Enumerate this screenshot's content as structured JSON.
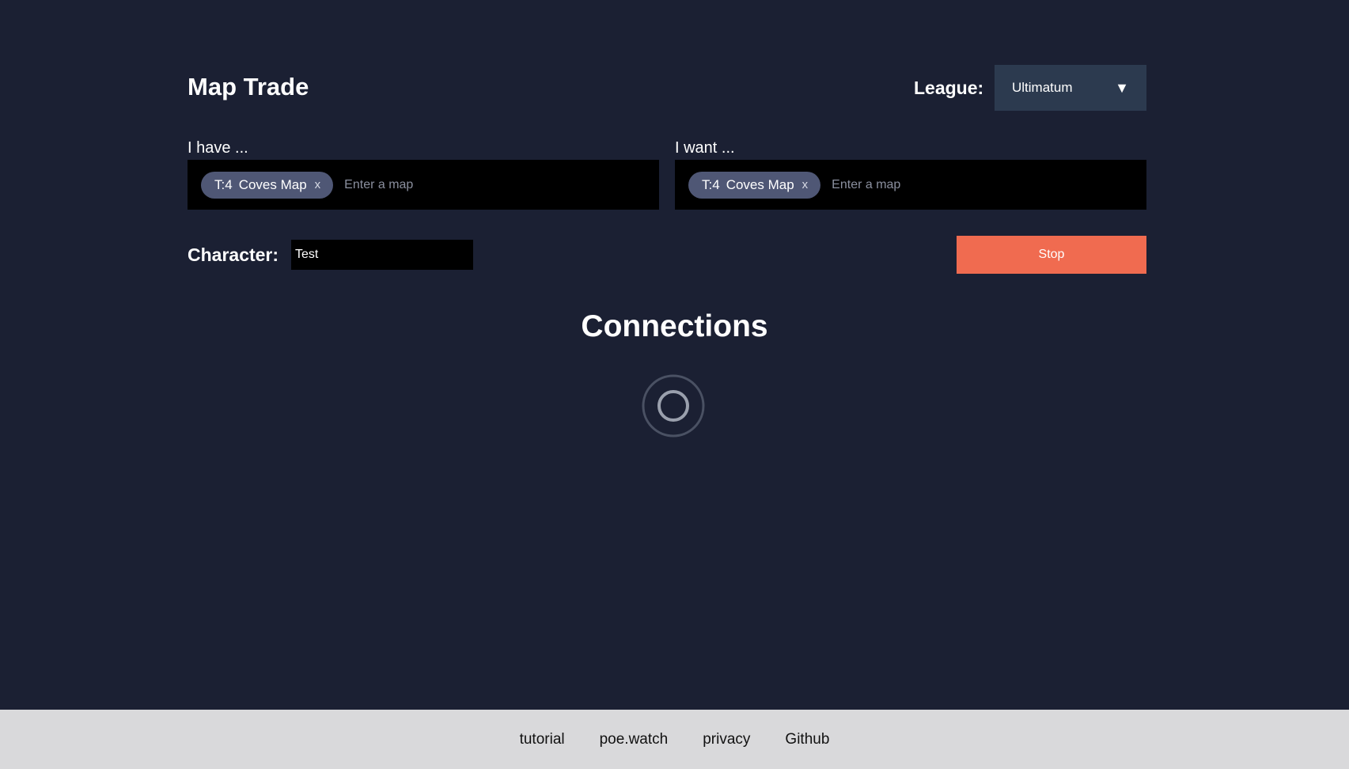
{
  "header": {
    "title": "Map Trade",
    "league_label": "League:",
    "league_value": "Ultimatum",
    "league_arrow": "▼"
  },
  "have": {
    "label": "I have ...",
    "tags": [
      {
        "tier": "T:4",
        "name": "Coves Map",
        "remove": "x"
      }
    ],
    "placeholder": "Enter a map"
  },
  "want": {
    "label": "I want ...",
    "tags": [
      {
        "tier": "T:4",
        "name": "Coves Map",
        "remove": "x"
      }
    ],
    "placeholder": "Enter a map"
  },
  "character": {
    "label": "Character:",
    "value": "Test"
  },
  "stop_button": {
    "label": "Stop",
    "color": "#f06b50"
  },
  "connections": {
    "title": "Connections"
  },
  "footer": {
    "links": [
      {
        "label": "tutorial"
      },
      {
        "label": "poe.watch"
      },
      {
        "label": "privacy"
      },
      {
        "label": "Github"
      }
    ]
  },
  "colors": {
    "background": "#1b2033",
    "select_bg": "#2c3a4f",
    "tag_bg": "#4f5775",
    "footer_bg": "#d9d9db"
  }
}
